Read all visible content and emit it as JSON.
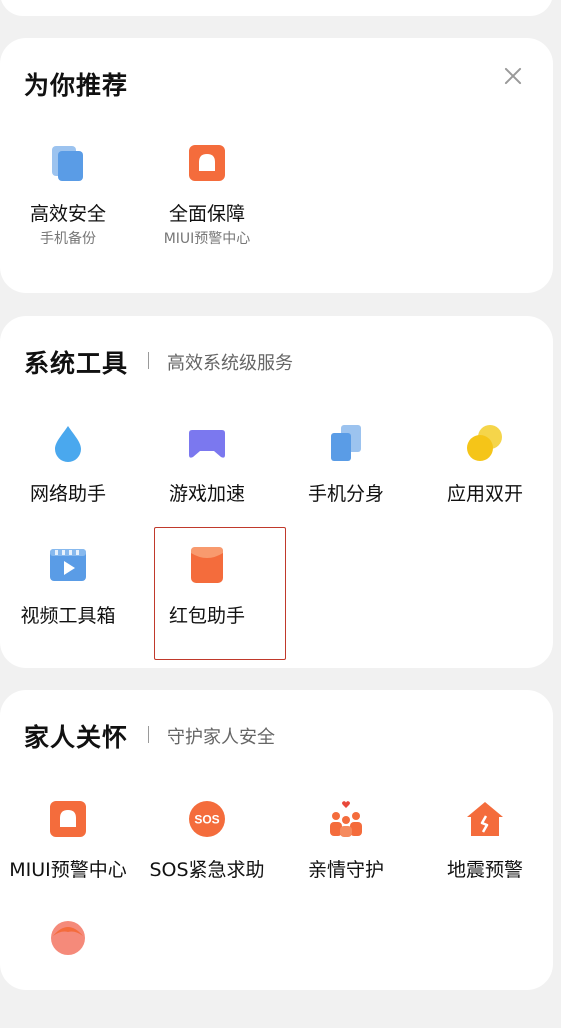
{
  "recommend": {
    "title": "为你推荐",
    "items": [
      {
        "label": "高效安全",
        "sub": "手机备份",
        "icon": "backup-icon"
      },
      {
        "label": "全面保障",
        "sub": "MIUI预警中心",
        "icon": "alarm-icon"
      }
    ]
  },
  "system_tools": {
    "title": "系统工具",
    "subtitle": "高效系统级服务",
    "items": [
      {
        "label": "网络助手",
        "icon": "water-drop-icon"
      },
      {
        "label": "游戏加速",
        "icon": "gamepad-icon"
      },
      {
        "label": "手机分身",
        "icon": "dual-phone-icon"
      },
      {
        "label": "应用双开",
        "icon": "dual-circle-icon"
      },
      {
        "label": "视频工具箱",
        "icon": "video-icon"
      },
      {
        "label": "红包助手",
        "icon": "red-envelope-icon"
      }
    ]
  },
  "family": {
    "title": "家人关怀",
    "subtitle": "守护家人安全",
    "items": [
      {
        "label": "MIUI预警中心",
        "icon": "alarm-icon"
      },
      {
        "label": "SOS紧急求助",
        "icon": "sos-icon"
      },
      {
        "label": "亲情守护",
        "icon": "family-icon"
      },
      {
        "label": "地震预警",
        "icon": "house-icon"
      }
    ]
  },
  "colors": {
    "accent_orange": "#f46c3c",
    "blue": "#5a9ce6",
    "purple": "#7b78ef",
    "yellow": "#f5c518",
    "highlight": "#c0392b"
  }
}
